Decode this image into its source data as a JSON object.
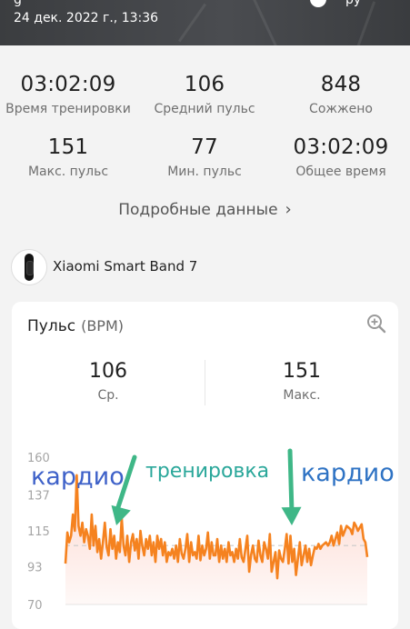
{
  "header": {
    "date": "24 дек. 2022 г., 13:36",
    "top_left_glyph": "g",
    "top_right_glyph": "ру"
  },
  "stats": [
    {
      "value": "03:02:09",
      "label": "Время тренировки"
    },
    {
      "value": "106",
      "label": "Средний пульс"
    },
    {
      "value": "848",
      "label": "Сожжено"
    },
    {
      "value": "151",
      "label": "Макс. пульс"
    },
    {
      "value": "77",
      "label": "Мин. пульс"
    },
    {
      "value": "03:02:09",
      "label": "Общее время"
    }
  ],
  "details_link": "Подробные данные",
  "device": {
    "name": "Xiaomi Smart Band 7",
    "icon": "smart-band-icon"
  },
  "pulse_card": {
    "title": "Пульс",
    "unit": "(BPM)",
    "zoom_icon": "zoom-in-icon",
    "summary": [
      {
        "value": "106",
        "label": "Ср."
      },
      {
        "value": "151",
        "label": "Макс."
      }
    ]
  },
  "annotations": {
    "left": "кардио",
    "middle": "тренировка",
    "right": "кардио",
    "left_color": "#3f62c9",
    "middle_color": "#2aa79a",
    "right_color": "#2f73c4",
    "arrow_color": "#3fb787"
  },
  "chart_data": {
    "type": "area",
    "title": "",
    "xlabel": "",
    "ylabel": "",
    "ylim": [
      70,
      160
    ],
    "yticks": [
      "160",
      "137",
      "115",
      "93",
      "70"
    ],
    "average_line": 106,
    "line_color": "#f5821f",
    "fill_color": "#fcd5cc",
    "series": [
      {
        "values": [
          95,
          114,
          108,
          112,
          125,
          115,
          149,
          118,
          112,
          120,
          108,
          116,
          112,
          104,
          125,
          106,
          118,
          102,
          110,
          98,
          108,
          120,
          105,
          100,
          116,
          104,
          112,
          98,
          108,
          102,
          123,
          106,
          100,
          112,
          96,
          108,
          113,
          103,
          110,
          98,
          115,
          106,
          100,
          110,
          104,
          112,
          100,
          108,
          96,
          112,
          104,
          110,
          100,
          108,
          96,
          102,
          100,
          104,
          98,
          106,
          96,
          110,
          101,
          98,
          104,
          113,
          96,
          108,
          100,
          102,
          98,
          112,
          97,
          106,
          100,
          104,
          114,
          98,
          108,
          100,
          100,
          110,
          96,
          106,
          98,
          104,
          96,
          108,
          100,
          102,
          96,
          104,
          98,
          110,
          99,
          96,
          104,
          112,
          90,
          100,
          106,
          98,
          96,
          109,
          100,
          96,
          108,
          104,
          98,
          113,
          90,
          96,
          102,
          86,
          103,
          98,
          96,
          104,
          113,
          95,
          112,
          96,
          104,
          88,
          98,
          108,
          94,
          100,
          106,
          96,
          104,
          94,
          100,
          105,
          104,
          107,
          104,
          106,
          107,
          108,
          106,
          108,
          112,
          106,
          110,
          114,
          107,
          118,
          112,
          115,
          118,
          117,
          116,
          113,
          120,
          118,
          115,
          117,
          119,
          110,
          108,
          99
        ]
      }
    ]
  }
}
